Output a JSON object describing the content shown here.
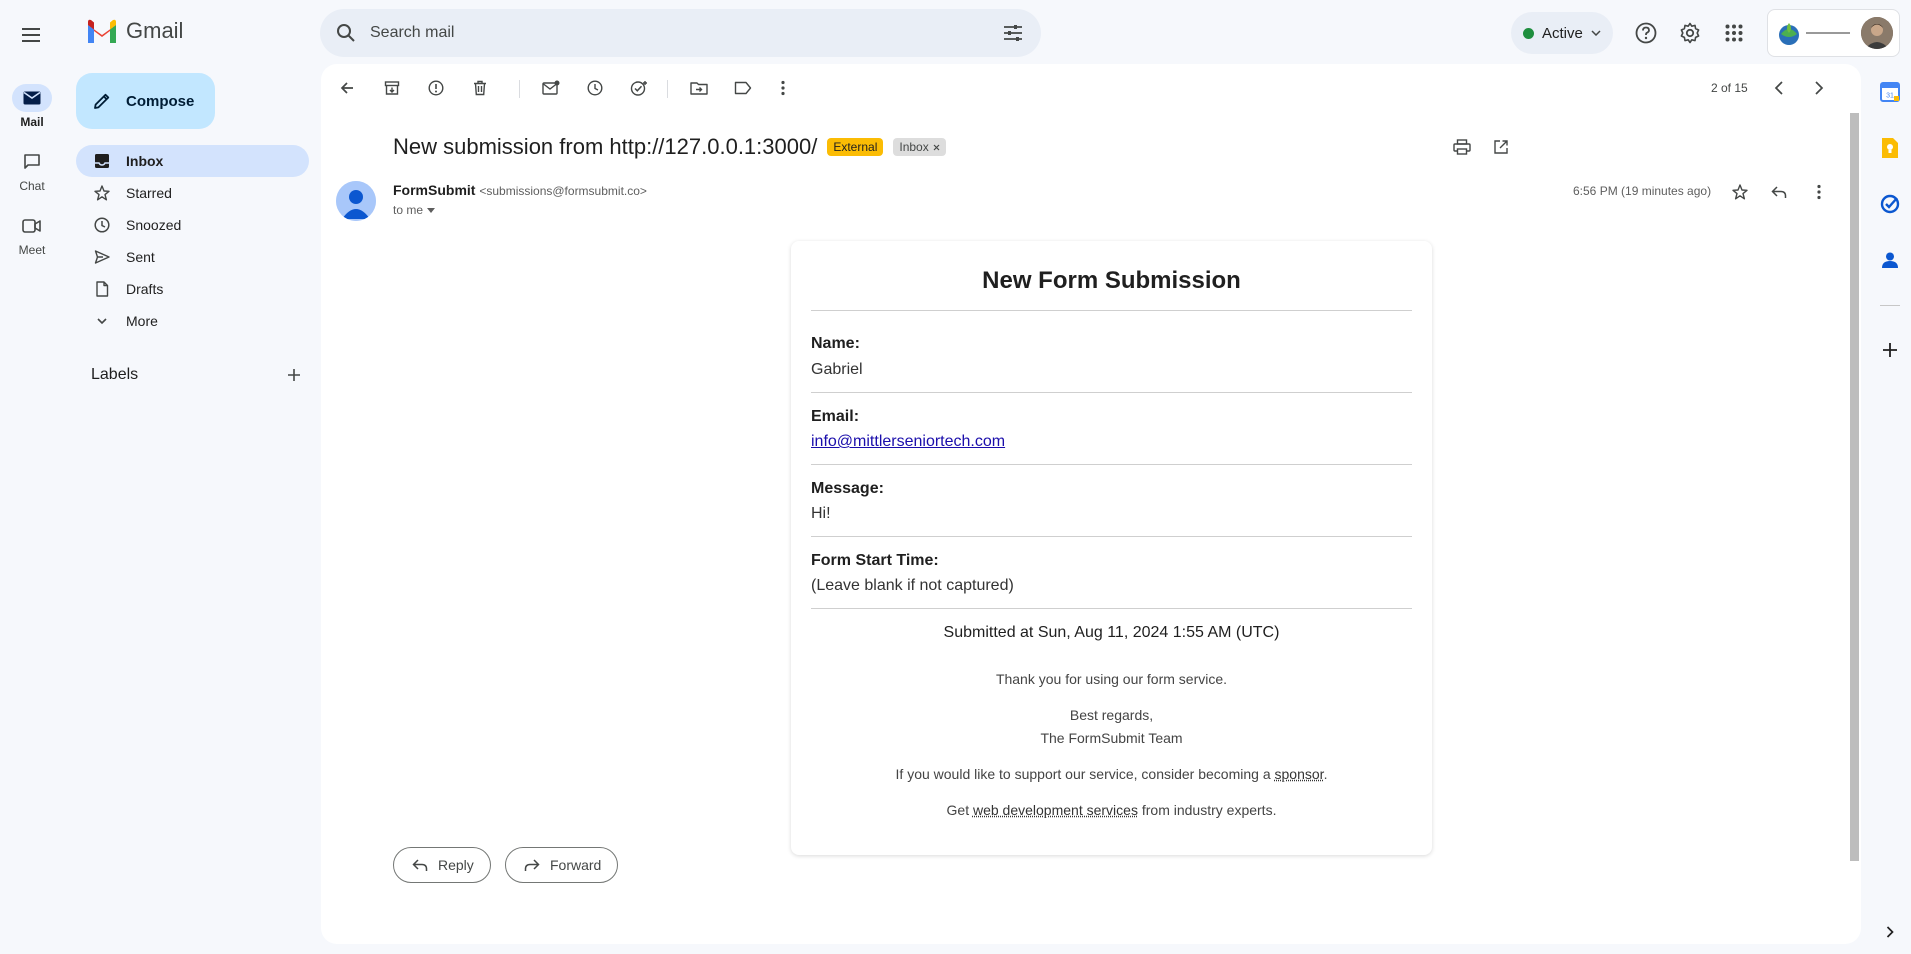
{
  "app": {
    "name": "Gmail"
  },
  "rail": [
    {
      "label": "Mail",
      "icon": "mail-icon",
      "active": true
    },
    {
      "label": "Chat",
      "icon": "chat-icon",
      "active": false
    },
    {
      "label": "Meet",
      "icon": "meet-icon",
      "active": false
    }
  ],
  "search": {
    "placeholder": "Search mail"
  },
  "status": {
    "label": "Active",
    "color": "#1e8e3e"
  },
  "compose": {
    "label": "Compose"
  },
  "nav": [
    {
      "label": "Inbox",
      "icon": "inbox-icon",
      "active": true
    },
    {
      "label": "Starred",
      "icon": "star-icon",
      "active": false
    },
    {
      "label": "Snoozed",
      "icon": "clock-icon",
      "active": false
    },
    {
      "label": "Sent",
      "icon": "send-icon",
      "active": false
    },
    {
      "label": "Drafts",
      "icon": "draft-icon",
      "active": false
    },
    {
      "label": "More",
      "icon": "chevron-down-icon",
      "active": false
    }
  ],
  "labels": {
    "title": "Labels"
  },
  "toolbar": {
    "pager": "2 of 15"
  },
  "email": {
    "subject": "New submission from http://127.0.0.1:3000/",
    "tag_external": "External",
    "tag_inbox": "Inbox",
    "sender_name": "FormSubmit",
    "sender_email": "<submissions@formsubmit.co>",
    "to": "to me",
    "time": "6:56 PM (19 minutes ago)"
  },
  "card": {
    "title": "New Form Submission",
    "fields": [
      {
        "label": "Name:",
        "value": "Gabriel"
      },
      {
        "label": "Email:",
        "value": "info@mittlerseniortech.com"
      },
      {
        "label": "Message:",
        "value": "Hi!"
      },
      {
        "label": "Form Start Time:",
        "value": "(Leave blank if not captured)"
      }
    ],
    "submitted": "Submitted at Sun, Aug 11, 2024 1:55 AM (UTC)",
    "thanks": "Thank you for using our form service.",
    "regards": "Best regards,",
    "team": "The FormSubmit Team",
    "support_pre": "If you would like to support our service, consider becoming a ",
    "support_link": "sponsor",
    "support_post": ".",
    "get_pre": "Get ",
    "get_link": "web development services",
    "get_post": " from industry experts."
  },
  "actions": {
    "reply": "Reply",
    "forward": "Forward"
  },
  "colors": {
    "accent": "#0b57d0",
    "compose_bg": "#c2e7ff",
    "nav_active": "#d3e3fd",
    "external_tag": "#fbbc04"
  }
}
